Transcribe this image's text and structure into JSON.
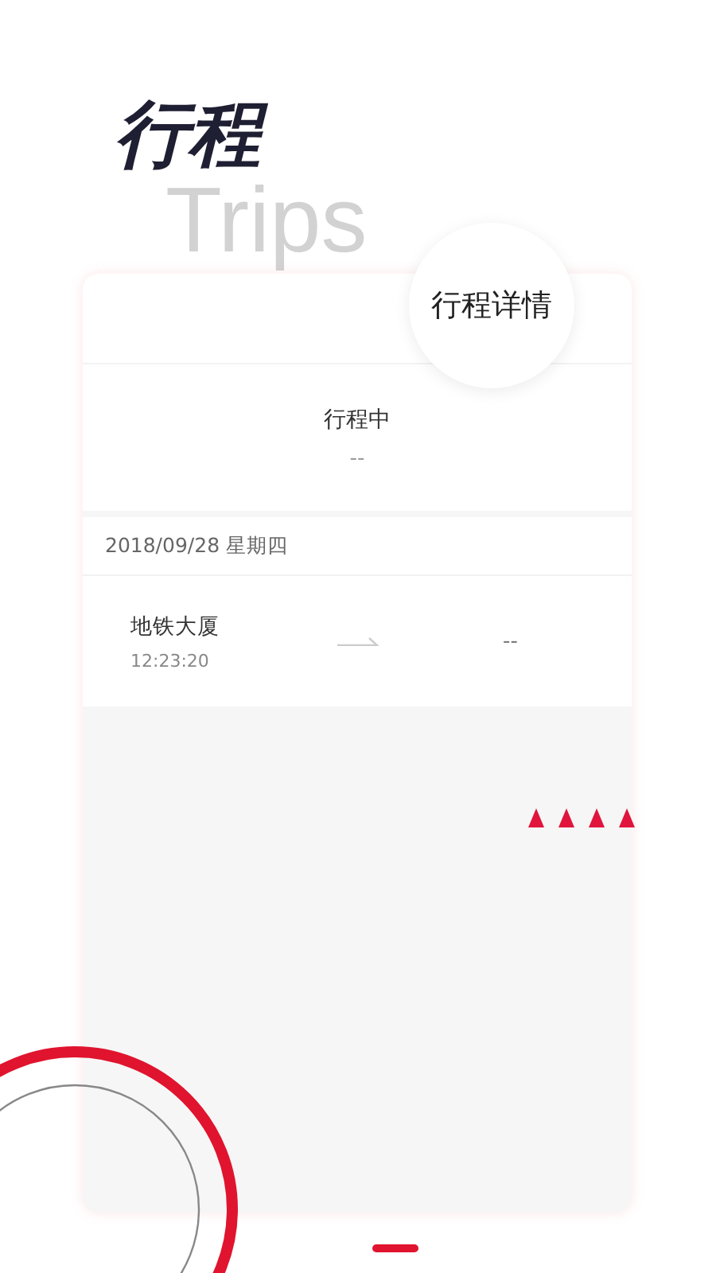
{
  "header": {
    "title": "行程",
    "subtitle": "Trips"
  },
  "card": {
    "detail_button": "行程详情",
    "status": "行程中",
    "status_value": "--",
    "date": "2018/09/28 星期四",
    "trip": {
      "origin": "地铁大厦",
      "time": "12:23:20",
      "destination": "--"
    }
  }
}
